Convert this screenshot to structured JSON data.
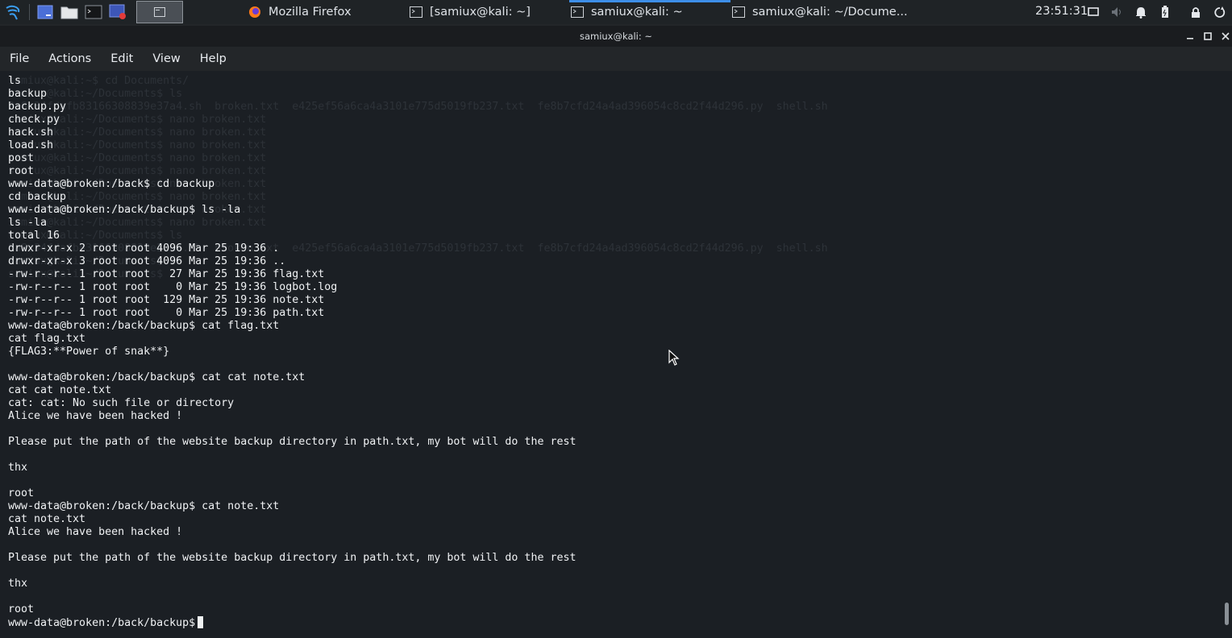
{
  "taskbar": {
    "tasks": [
      {
        "label": "Mozilla Firefox",
        "icon": "firefox-icon"
      },
      {
        "label": "[samiux@kali: ~]",
        "icon": "terminal-icon"
      },
      {
        "label": "samiux@kali: ~",
        "icon": "terminal-icon",
        "active": true
      },
      {
        "label": "samiux@kali: ~/Docume...",
        "icon": "terminal-icon"
      }
    ],
    "clock": "23:51:31",
    "tray_icons": [
      "display-icon",
      "volume-icon",
      "notifications-bell-icon",
      "battery-icon",
      "lock-icon",
      "power-icon"
    ],
    "accent": "#3d8ee8"
  },
  "window": {
    "title": "samiux@kali: ~"
  },
  "menu": [
    "File",
    "Actions",
    "Edit",
    "View",
    "Help"
  ],
  "terminal": {
    "lines": [
      "ls",
      "backup",
      "backup.py",
      "check.py",
      "hack.sh",
      "load.sh",
      "post",
      "root",
      "www-data@broken:/back$ cd backup",
      "cd backup",
      "www-data@broken:/back/backup$ ls -la",
      "ls -la",
      "total 16",
      "drwxr-xr-x 2 root root 4096 Mar 25 19:36 .",
      "drwxr-xr-x 3 root root 4096 Mar 25 19:36 ..",
      "-rw-r--r-- 1 root root   27 Mar 25 19:36 flag.txt",
      "-rw-r--r-- 1 root root    0 Mar 25 19:36 logbot.log",
      "-rw-r--r-- 1 root root  129 Mar 25 19:36 note.txt",
      "-rw-r--r-- 1 root root    0 Mar 25 19:36 path.txt",
      "www-data@broken:/back/backup$ cat flag.txt",
      "cat flag.txt",
      "{FLAG3:**Power of snak**}",
      "",
      "www-data@broken:/back/backup$ cat cat note.txt",
      "cat cat note.txt",
      "cat: cat: No such file or directory",
      "Alice we have been hacked !",
      "",
      "Please put the path of the website backup directory in path.txt, my bot will do the rest",
      "",
      "thx",
      "",
      "root",
      "www-data@broken:/back/backup$ cat note.txt",
      "cat note.txt",
      "Alice we have been hacked !",
      "",
      "Please put the path of the website backup directory in path.txt, my bot will do the rest",
      "",
      "thx",
      "",
      "root"
    ],
    "prompt": "www-data@broken:/back/backup$",
    "ghost_lines": [
      "samiux@kali:~$ cd Documents/",
      "samiux@kali:~/Documents$ ls",
      "0a8c34fdafb83166308839e37a4.sh  broken.txt  e425ef56a6ca4a3101e775d5019fb237.txt  fe8b7cfd24a4ad396054c8cd2f44d296.py  shell.sh",
      "samiux@kali:~/Documents$ nano broken.txt",
      "samiux@kali:~/Documents$ nano broken.txt",
      "samiux@kali:~/Documents$ nano broken.txt",
      "samiux@kali:~/Documents$ nano broken.txt",
      "samiux@kali:~/Documents$ nano broken.txt",
      "samiux@kali:~/Documents$ nano broken.txt",
      "samiux@kali:~/Documents$ nano broken.txt",
      "samiux@kali:~/Documents$ nano broken.txt",
      "samiux@kali:~/Documents$ nano broken.txt",
      "samiux@kali:~/Documents$ ls",
      "0a8c34fdafb83166308839e37a4.sh  broken.txt  e425ef56a6ca4a3101e775d5019fb237.txt  fe8b7cfd24a4ad396054c8cd2f44d296.py  shell.sh",
      "samiux@kali:~/Documents$ ls",
      "samiux@kali:~/Documents$ "
    ]
  }
}
